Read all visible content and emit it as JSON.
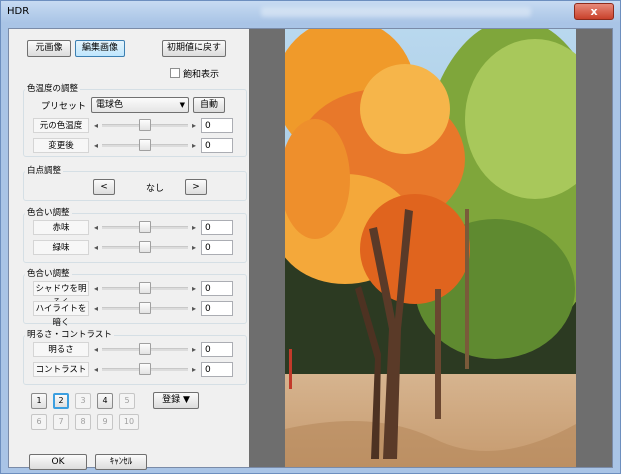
{
  "window": {
    "title": "HDR",
    "close_glyph": "x"
  },
  "toolbar": {
    "original_label": "元画像",
    "edited_label": "編集画像",
    "reset_label": "初期値に戻す",
    "saturation_label": "飽和表示"
  },
  "color_temp": {
    "group_label": "色温度の調整",
    "preset_label": "プリセット",
    "preset_value": "電球色",
    "auto_label": "自動",
    "rows": [
      {
        "label": "元の色温度",
        "value": "0",
        "level": 0.5
      },
      {
        "label": "変更後",
        "value": "0",
        "level": 0.5
      }
    ]
  },
  "white_point": {
    "group_label": "白点調整",
    "prev_label": "<",
    "value": "なし",
    "next_label": ">"
  },
  "tint": {
    "group_label": "色合い調整",
    "rows": [
      {
        "label": "赤味",
        "value": "0",
        "level": 0.5
      },
      {
        "label": "緑味",
        "value": "0",
        "level": 0.5
      }
    ]
  },
  "tone": {
    "group_label": "色合い調整",
    "rows": [
      {
        "label": "シャドウを明るく",
        "value": "0",
        "level": 0.5
      },
      {
        "label": "ハイライトを暗く",
        "value": "0",
        "level": 0.5
      }
    ]
  },
  "brightness": {
    "group_label": "明るさ・コントラスト",
    "rows": [
      {
        "label": "明るさ",
        "value": "0",
        "level": 0.5
      },
      {
        "label": "コントラスト",
        "value": "0",
        "level": 0.5
      }
    ]
  },
  "presets": {
    "slots": [
      "1",
      "2",
      "3",
      "4",
      "5",
      "6",
      "7",
      "8",
      "9",
      "10"
    ],
    "selected": "2",
    "register_label": "登録 ▼"
  },
  "footer": {
    "ok_label": "OK",
    "cancel_label": "ｷｬﾝｾﾙ"
  },
  "colors": {
    "accent": "#3c7fb1",
    "close": "#c8412b",
    "preview_bg": "#6e6e6e"
  }
}
